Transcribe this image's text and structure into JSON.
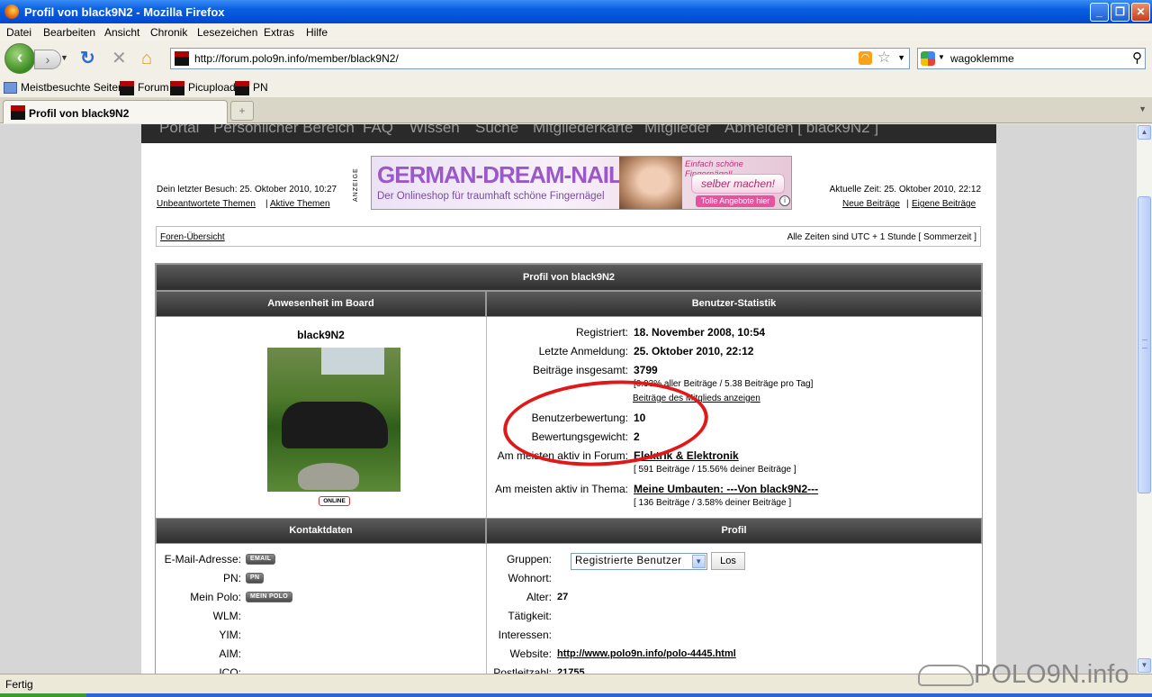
{
  "window": {
    "title": "Profil von black9N2 - Mozilla Firefox"
  },
  "menu": [
    "Datei",
    "Bearbeiten",
    "Ansicht",
    "Chronik",
    "Lesezeichen",
    "Extras",
    "Hilfe"
  ],
  "nav": {
    "url": "http://forum.polo9n.info/member/black9N2/",
    "search_value": "wagoklemme"
  },
  "bookmarks": [
    "Meistbesuchte Seiten",
    "Forum",
    "Picupload",
    "PN"
  ],
  "tab": {
    "label": "Profil von black9N2"
  },
  "status": "Fertig",
  "watermark": "POLO9N.info",
  "forum": {
    "topnav": [
      "Portal",
      "Persönlicher Bereich",
      "FAQ",
      "Wissen",
      "Suche",
      "Mitgliederkarte",
      "Mitglieder",
      "Abmelden [ black9N2 ]"
    ],
    "last_visit": "Dein letzter Besuch: 25. Oktober 2010, 10:27",
    "unanswered": "Unbeantwortete Themen",
    "active_topics": "Aktive Themen",
    "separator": "|",
    "anzeige": "ANZEIGE",
    "ad": {
      "headline": "GERMAN-DREAM-NAILS",
      "sub": "Der Onlineshop für traumhaft schöne Fingernägel",
      "slogan": "Einfach schöne Fingernägel!",
      "cta": "selber machen!",
      "offers": "Tolle Angebote hier",
      "info": "i"
    },
    "current_time": "Aktuelle Zeit: 25. Oktober 2010, 22:12",
    "new_posts": "Neue Beiträge",
    "own_posts": "Eigene Beiträge",
    "forum_index": "Foren-Übersicht",
    "timezone": "Alle Zeiten sind UTC + 1 Stunde [ Sommerzeit ]",
    "profile_title": "Profil von black9N2",
    "presence_header": "Anwesenheit im Board",
    "stats_header": "Benutzer-Statistik",
    "username": "black9N2",
    "online_badge": "ONLINE",
    "stats": {
      "registered_label": "Registriert:",
      "registered": "18. November 2008, 10:54",
      "lastlogin_label": "Letzte Anmeldung:",
      "lastlogin": "25. Oktober 2010, 22:12",
      "posts_label": "Beiträge insgesamt:",
      "posts": "3799",
      "posts_detail": "[0.93% aller Beiträge / 5.38 Beiträge pro Tag]",
      "show_posts": "Beiträge des Mitglieds anzeigen",
      "rating_label": "Benutzerbewertung:",
      "rating": "10",
      "weight_label": "Bewertungsgewicht:",
      "weight": "2",
      "active_forum_label": "Am meisten aktiv in Forum:",
      "active_forum": "Elektrik & Elektronik",
      "active_forum_detail": "[ 591 Beiträge / 15.56% deiner Beiträge ]",
      "active_topic_label": "Am meisten aktiv in Thema:",
      "active_topic": "Meine Umbauten: ---Von black9N2---",
      "active_topic_detail": "[ 136 Beiträge / 3.58% deiner Beiträge ]"
    },
    "contact_header": "Kontaktdaten",
    "profile_header": "Profil",
    "contact": {
      "email_label": "E-Mail-Adresse:",
      "email_badge": "EMAIL",
      "pn_label": "PN:",
      "pn_badge": "PN",
      "polo_label": "Mein Polo:",
      "polo_badge": "MEIN POLO",
      "wlm_label": "WLM:",
      "yim_label": "YIM:",
      "aim_label": "AIM:",
      "icq_label": "ICQ:"
    },
    "profile": {
      "groups_label": "Gruppen:",
      "groups_value": "Registrierte Benutzer",
      "go": "Los",
      "residence_label": "Wohnort:",
      "age_label": "Alter:",
      "age": "27",
      "job_label": "Tätigkeit:",
      "interests_label": "Interessen:",
      "website_label": "Website:",
      "website": "http://www.polo9n.info/polo-4445.html",
      "zip_label": "Postleitzahl:",
      "zip": "21755"
    }
  }
}
